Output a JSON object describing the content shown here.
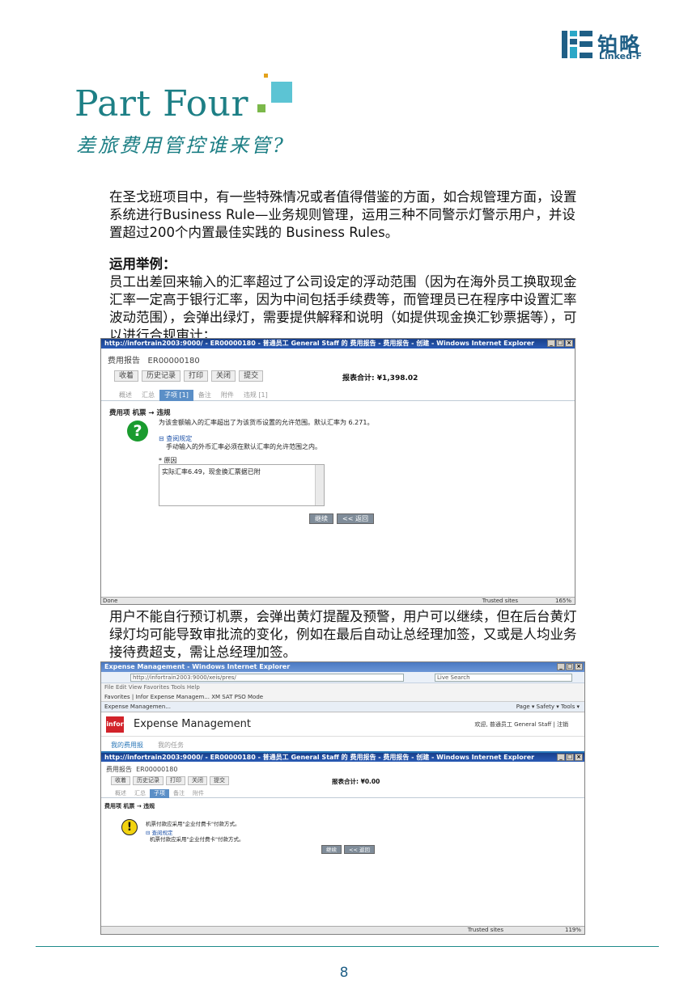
{
  "header": {
    "logo_cn": "铂略",
    "logo_en": "Linked-F",
    "title": "Part Four",
    "subtitle": "差旅费用管控谁来管?"
  },
  "content": {
    "para1": "在圣戈班项目中，有一些特殊情况或者值得借鉴的方面，如合规管理方面，设置系统进行Business Rule—业务规则管理，运用三种不同警示灯警示用户，并设置超过200个内置最佳实践的 Business Rules。",
    "example_heading": "运用举例：",
    "para2": "员工出差回来输入的汇率超过了公司设定的浮动范围（因为在海外员工换取现金汇率一定高于银行汇率，因为中间包括手续费等，而管理员已在程序中设置汇率波动范围），会弹出绿灯，需要提供解释和说明（如提供现金换汇钞票据等），可以进行合规审计；",
    "para3": "用户不能自行预订机票，会弹出黄灯提醒及预警，用户可以继续，但在后台黄灯绿灯均可能导致审批流的变化，例如在最后自动让总经理加签，又或是人均业务接待费超支，需让总经理加签。"
  },
  "screenshot1": {
    "window_title": "http://infortrain2003:9000/ - ER00000180 - 普通员工 General Staff 的 费用报告 - 费用报告 - 创建 - Windows Internet Explorer",
    "report_label": "费用报告",
    "report_id": "ER00000180",
    "toolbar": [
      "收着",
      "历史记录",
      "打印",
      "关闭",
      "提交"
    ],
    "total": "报表合计: ¥1,398.02",
    "tabs": [
      "概述",
      "汇总",
      "子项 [1]",
      "备注",
      "附件",
      "违规 [1]"
    ],
    "crumb": "费用项 机票 → 违规",
    "message": "为该金额输入的汇率超出了为该货币设置的允许范围。默认汇率为 6.271。",
    "link": "⊟ 查阅规定",
    "sub_message": "手动输入的外币汇率必须在默认汇率的允许范围之内。",
    "reason_label": "* 原因",
    "reason_value": "实际汇率6.49，现金换汇票据已附",
    "continue": "继续",
    "back": "<< 返回",
    "status_left": "Done",
    "status_zone": "Trusted sites",
    "status_zoom": "165%"
  },
  "screenshot2": {
    "window_title": "Expense Management - Windows Internet Explorer",
    "address": "http://infortrain2003:9000/xeis/pres/",
    "search_placeholder": "Live Search",
    "menu": "File   Edit   View   Favorites   Tools   Help",
    "favorites": "Favorites  |  Infor Expense Managem...   XM SAT PSO Mode",
    "tab_label": "Expense Managemen...",
    "commands": "Page ▾  Safety ▾  Tools ▾",
    "brand": "infor",
    "app_title": "Expense Management",
    "user": "欢迎, 普通员工 General Staff  |  注销",
    "app_tabs": [
      "我的费用报",
      "我的任务"
    ],
    "inner_title": "http://infortrain2003:9000/ - ER00000180 - 普通员工 General Staff 的 费用报告 - 费用报告 - 创建 - Windows Internet Explorer",
    "report_label": "费用报告",
    "report_id": "ER00000180",
    "toolbar": [
      "收着",
      "历史记录",
      "打印",
      "关闭",
      "提交"
    ],
    "total": "报表合计: ¥0.00",
    "tabs": [
      "概述",
      "汇总",
      "子项",
      "备注",
      "附件"
    ],
    "crumb": "费用项 机票 → 违规",
    "message": "机票付款应采用\"企业付费卡\"付款方式。",
    "link": "⊟ 查阅规定",
    "sub_message": "机票付款应采用\"企业付费卡\"付款方式。",
    "continue": "继续",
    "back": "<< 返回",
    "status_zone": "Trusted sites",
    "status_zoom": "119%"
  },
  "footer": {
    "page_number": "8"
  }
}
